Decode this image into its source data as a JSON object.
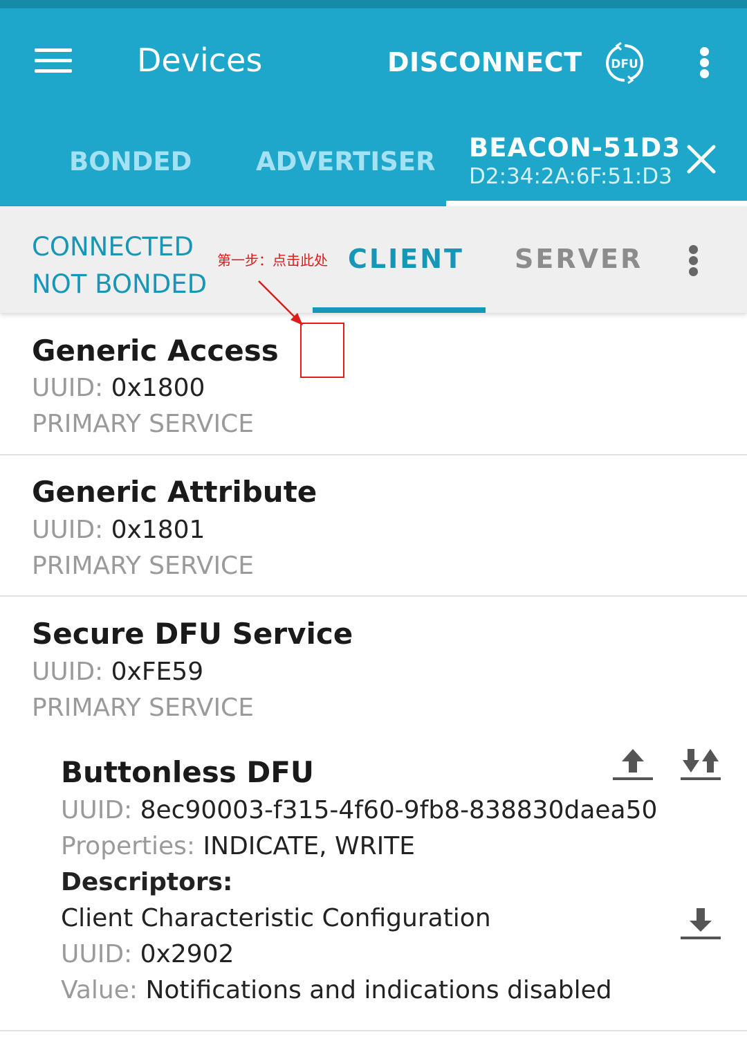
{
  "appbar": {
    "title": "Devices",
    "disconnect_label": "DISCONNECT",
    "dfu_icon": "dfu-icon",
    "overflow_icon": "more-vert-icon",
    "menu_icon": "menu-icon"
  },
  "tabs": {
    "bonded": "BONDED",
    "advertiser": "ADVERTISER",
    "device_name": "BEACON-51D3",
    "device_address": "D2:34:2A:6F:51:D3",
    "close_icon": "close-icon"
  },
  "subbar": {
    "status_line1": "CONNECTED",
    "status_line2": "NOT BONDED",
    "client": "CLIENT",
    "server": "SERVER",
    "annotation": "第一步：点击此处"
  },
  "services": [
    {
      "name": "Generic Access",
      "uuid_label": "UUID:",
      "uuid": "0x1800",
      "type": "PRIMARY SERVICE"
    },
    {
      "name": "Generic Attribute",
      "uuid_label": "UUID:",
      "uuid": "0x1801",
      "type": "PRIMARY SERVICE"
    },
    {
      "name": "Secure DFU Service",
      "uuid_label": "UUID:",
      "uuid": "0xFE59",
      "type": "PRIMARY SERVICE"
    }
  ],
  "characteristic": {
    "name": "Buttonless DFU",
    "uuid_label": "UUID:",
    "uuid": "8ec90003-f315-4f60-9fb8-838830daea50",
    "properties_label": "Properties:",
    "properties": "INDICATE, WRITE",
    "descriptors_label": "Descriptors:",
    "descriptor_name": "Client Characteristic Configuration",
    "descriptor_uuid_label": "UUID:",
    "descriptor_uuid": "0x2902",
    "value_label": "Value:",
    "value": "Notifications and indications disabled"
  },
  "colors": {
    "appbar": "#1ea6cb",
    "accent": "#1697b8",
    "annotation": "#e11a1a"
  }
}
